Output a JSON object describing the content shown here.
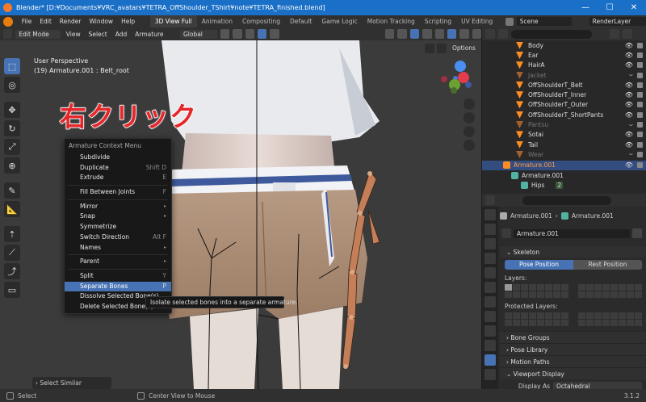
{
  "window": {
    "title": "Blender* [D:¥Documents¥VRC_avatars¥TETRA_OffShoulder_TShirt¥note¥TETRA_finished.blend]"
  },
  "menubar": {
    "items": [
      "File",
      "Edit",
      "Render",
      "Window",
      "Help"
    ]
  },
  "workspaces": [
    "3D View Full",
    "Animation",
    "Compositing",
    "Default",
    "Game Logic",
    "Motion Tracking",
    "Scripting",
    "UV Editing"
  ],
  "active_workspace": "3D View Full",
  "scene": "Scene",
  "view_layer": "RenderLayer",
  "viewport_header": {
    "mode": "Edit Mode",
    "menus": [
      "View",
      "Select",
      "Add",
      "Armature"
    ],
    "orientation": "Global",
    "options": "Options"
  },
  "viewport": {
    "perspective": "User Perspective",
    "object_info": "(19) Armature.001 : Belt_root",
    "annotation": "右クリック",
    "gizmo_axes": {
      "x": "X",
      "y": "Y",
      "z": "Z"
    }
  },
  "context_menu": {
    "title": "Armature Context Menu",
    "items": [
      {
        "label": "Subdivide",
        "shortcut": ""
      },
      {
        "label": "Duplicate",
        "shortcut": "Shift D"
      },
      {
        "label": "Extrude",
        "shortcut": "E"
      },
      {
        "sep": true
      },
      {
        "label": "Fill Between Joints",
        "shortcut": "F"
      },
      {
        "sep": true
      },
      {
        "label": "Mirror",
        "shortcut": "▸",
        "sub": true
      },
      {
        "label": "Snap",
        "shortcut": "▸",
        "sub": true
      },
      {
        "label": "Symmetrize",
        "shortcut": ""
      },
      {
        "label": "Switch Direction",
        "shortcut": "Alt F"
      },
      {
        "label": "Names",
        "shortcut": "▸",
        "sub": true
      },
      {
        "sep": true
      },
      {
        "label": "Parent",
        "shortcut": "▸",
        "sub": true
      },
      {
        "sep": true
      },
      {
        "label": "Split",
        "shortcut": "Y"
      },
      {
        "label": "Separate Bones",
        "shortcut": "P",
        "selected": true
      },
      {
        "label": "Dissolve Selected Bone(s)",
        "shortcut": ""
      },
      {
        "label": "Delete Selected Bone(s)",
        "shortcut": ""
      }
    ]
  },
  "tooltip": "Isolate selected bones into a separate armature.",
  "last_operator": "Select Similar",
  "statusbar": {
    "left": "Select",
    "middle": "Center View to Mouse",
    "version": "3.1.2"
  },
  "outliner": {
    "rows": [
      {
        "label": "Body",
        "dim": false
      },
      {
        "label": "Ear",
        "dim": false
      },
      {
        "label": "HairA",
        "dim": false
      },
      {
        "label": "Jacket",
        "dim": true
      },
      {
        "label": "OffShoulderT_Belt",
        "dim": false
      },
      {
        "label": "OffShoulderT_Inner",
        "dim": false
      },
      {
        "label": "OffShoulderT_Outer",
        "dim": false
      },
      {
        "label": "OffShoulderT_ShortPants",
        "dim": false
      },
      {
        "label": "Pantsu",
        "dim": true
      },
      {
        "label": "Sotai",
        "dim": false
      },
      {
        "label": "Tail",
        "dim": false
      },
      {
        "label": "Wear",
        "dim": true
      }
    ],
    "armature_collection": "Armature.001",
    "armature_object": "Armature.001",
    "bone_root": "Hips",
    "hips_count": "2"
  },
  "properties": {
    "breadcrumb": [
      "Armature.001",
      "Armature.001"
    ],
    "datablock": "Armature.001",
    "skeleton_label": "Skeleton",
    "pose_position": "Pose Position",
    "rest_position": "Rest Position",
    "layers_label": "Layers:",
    "protected_layers_label": "Protected Layers:",
    "sections": [
      "Bone Groups",
      "Pose Library",
      "Motion Paths",
      "Viewport Display"
    ],
    "display_as_label": "Display As",
    "display_as_value": "Octahedral"
  },
  "colors": {
    "accent": "#4772b3",
    "titlebar": "#1a6fc7",
    "annotation": "#e5262a",
    "object_icon": "#ff8d24"
  }
}
